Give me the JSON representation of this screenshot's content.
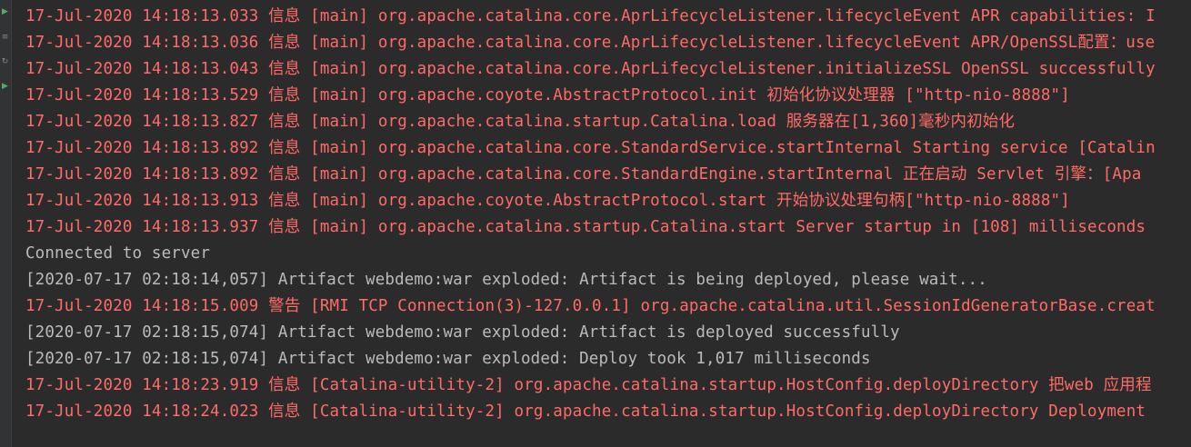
{
  "colors": {
    "background": "#2b2b2b",
    "stderr_text": "#ff6b68",
    "stdout_text": "#bbbbbb",
    "gutter": "#313335"
  },
  "gutter_icons": [
    "run-icon",
    "settings-icon",
    "restore-icon",
    "run-icon"
  ],
  "lines": [
    {
      "stream": "err",
      "text": "17-Jul-2020 14:18:13.033 信息 [main] org.apache.catalina.core.AprLifecycleListener.lifecycleEvent APR capabilities: I"
    },
    {
      "stream": "err",
      "text": "17-Jul-2020 14:18:13.036 信息 [main] org.apache.catalina.core.AprLifecycleListener.lifecycleEvent APR/OpenSSL配置：use"
    },
    {
      "stream": "err",
      "text": "17-Jul-2020 14:18:13.043 信息 [main] org.apache.catalina.core.AprLifecycleListener.initializeSSL OpenSSL successfully"
    },
    {
      "stream": "err",
      "text": "17-Jul-2020 14:18:13.529 信息 [main] org.apache.coyote.AbstractProtocol.init 初始化协议处理器 [\"http-nio-8888\"]"
    },
    {
      "stream": "err",
      "text": "17-Jul-2020 14:18:13.827 信息 [main] org.apache.catalina.startup.Catalina.load 服务器在[1,360]毫秒内初始化"
    },
    {
      "stream": "err",
      "text": "17-Jul-2020 14:18:13.892 信息 [main] org.apache.catalina.core.StandardService.startInternal Starting service [Catalin"
    },
    {
      "stream": "err",
      "text": "17-Jul-2020 14:18:13.892 信息 [main] org.apache.catalina.core.StandardEngine.startInternal 正在启动 Servlet 引擎：[Apa"
    },
    {
      "stream": "err",
      "text": "17-Jul-2020 14:18:13.913 信息 [main] org.apache.coyote.AbstractProtocol.start 开始协议处理句柄[\"http-nio-8888\"]"
    },
    {
      "stream": "err",
      "text": "17-Jul-2020 14:18:13.937 信息 [main] org.apache.catalina.startup.Catalina.start Server startup in [108] milliseconds"
    },
    {
      "stream": "out",
      "text": "Connected to server"
    },
    {
      "stream": "out",
      "text": "[2020-07-17 02:18:14,057] Artifact webdemo:war exploded: Artifact is being deployed, please wait..."
    },
    {
      "stream": "err",
      "text": "17-Jul-2020 14:18:15.009 警告 [RMI TCP Connection(3)-127.0.0.1] org.apache.catalina.util.SessionIdGeneratorBase.creat"
    },
    {
      "stream": "out",
      "text": "[2020-07-17 02:18:15,074] Artifact webdemo:war exploded: Artifact is deployed successfully"
    },
    {
      "stream": "out",
      "text": "[2020-07-17 02:18:15,074] Artifact webdemo:war exploded: Deploy took 1,017 milliseconds"
    },
    {
      "stream": "err",
      "text": "17-Jul-2020 14:18:23.919 信息 [Catalina-utility-2] org.apache.catalina.startup.HostConfig.deployDirectory 把web 应用程"
    },
    {
      "stream": "err",
      "text": "17-Jul-2020 14:18:24.023 信息 [Catalina-utility-2] org.apache.catalina.startup.HostConfig.deployDirectory Deployment"
    }
  ]
}
